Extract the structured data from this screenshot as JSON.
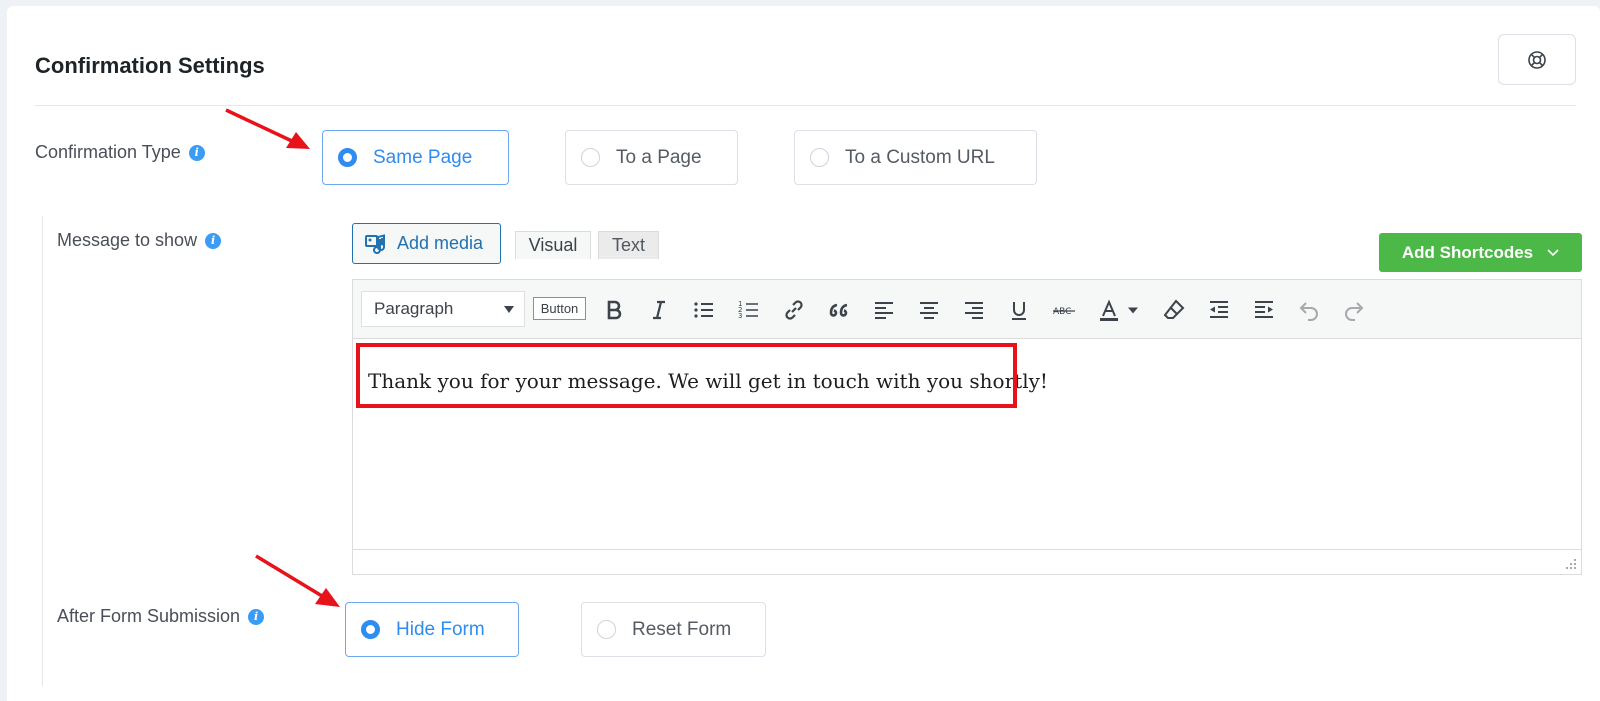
{
  "header": {
    "title": "Confirmation Settings",
    "help_icon": "lifebuoy-icon"
  },
  "confirmation_type": {
    "label": "Confirmation Type",
    "options": [
      {
        "label": "Same Page",
        "selected": true
      },
      {
        "label": "To a Page",
        "selected": false
      },
      {
        "label": "To a Custom URL",
        "selected": false
      }
    ]
  },
  "message": {
    "label": "Message to show",
    "add_media_label": "Add media",
    "tabs": [
      "Visual",
      "Text"
    ],
    "shortcodes_label": "Add Shortcodes",
    "format_select": "Paragraph",
    "button_label": "Button",
    "content": "Thank you for your message. We will get in touch with you shortly!"
  },
  "after_submission": {
    "label": "After Form Submission",
    "options": [
      {
        "label": "Hide Form",
        "selected": true
      },
      {
        "label": "Reset Form",
        "selected": false
      }
    ]
  },
  "colors": {
    "accent": "#2f8cf0",
    "shortcodes_button": "#4cb847",
    "annotation": "#e8121b"
  }
}
